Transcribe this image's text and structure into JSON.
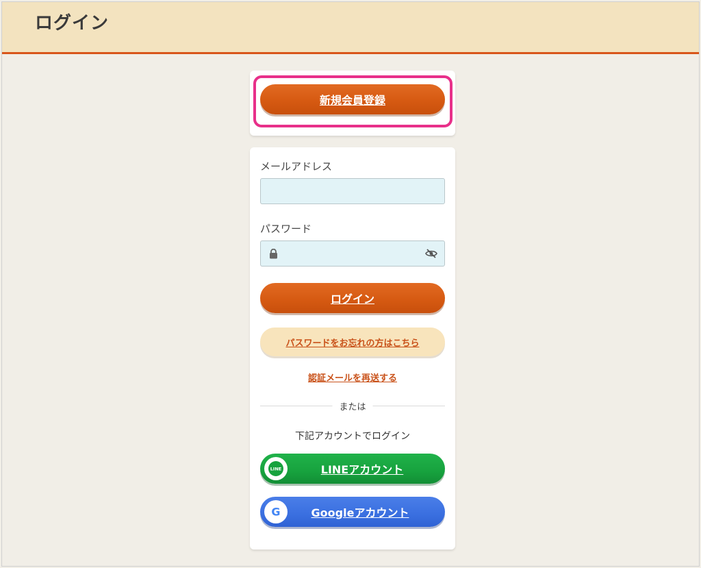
{
  "header": {
    "title": "ログイン"
  },
  "register": {
    "button_label": "新規会員登録"
  },
  "login_form": {
    "email_label": "メールアドレス",
    "email_value": "",
    "password_label": "パスワード",
    "password_value": "",
    "login_button_label": "ログイン",
    "forgot_password_label": "パスワードをお忘れの方はこちら",
    "resend_verification_label": "認証メールを再送する"
  },
  "divider": {
    "text": "または"
  },
  "social": {
    "caption": "下記アカウントでログイン",
    "line_label": "LINEアカウント",
    "line_badge_text": "LINE",
    "google_label": "Googleアカウント",
    "google_badge_text": "G"
  },
  "icons": {
    "password_lock": "lock-icon",
    "password_toggle": "eye-slash-icon",
    "line_logo": "line-logo-icon",
    "google_logo": "google-logo-icon"
  },
  "colors": {
    "accent_orange": "#d65a12",
    "header_bg": "#f3e3bf",
    "header_border": "#d8561b",
    "highlight_pink": "#e8308a",
    "line_green": "#17a23e",
    "google_blue": "#3a6fe0",
    "input_bg": "#e2f3f7",
    "forgot_bg": "#f8e4bc"
  }
}
